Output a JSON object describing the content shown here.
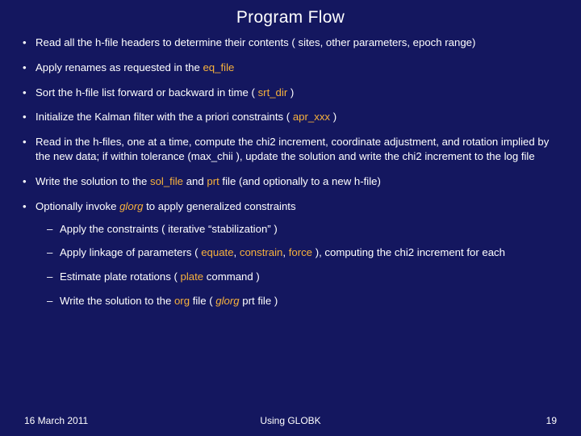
{
  "title": "Program Flow",
  "bullets": {
    "b1": "Read all the h-file headers to determine their contents ( sites, other parameters, epoch range)",
    "b2a": "Apply renames as requested in the ",
    "b2kw": "eq_file",
    "b3a": "Sort the h-file list  forward or backward in time ( ",
    "b3kw": "srt_dir",
    "b3b": " )",
    "b4a": "Initialize the Kalman filter with the a priori constraints ( ",
    "b4kw": "apr_xxx",
    "b4b": " )",
    "b5": "Read in the h-files, one at a time, compute the chi2 increment, coordinate adjustment, and rotation implied by the new data; if within tolerance (max_chii ), update the solution and write the chi2 increment to the log file",
    "b6a": "Write the solution to the ",
    "b6kw1": "sol_file",
    "b6b": " and ",
    "b6kw2": "prt",
    "b6c": " file (and optionally to a new h-file)",
    "b7a": "Optionally invoke ",
    "b7kw": "glorg",
    "b7b": " to apply generalized constraints"
  },
  "sub": {
    "s1": "Apply the constraints ( iterative “stabilization” )",
    "s2a": "Apply linkage of parameters ( ",
    "s2kw1": "equate",
    "s2b": ", ",
    "s2kw2": "constrain",
    "s2c": ", ",
    "s2kw3": "force",
    "s2d": " ), computing the chi2 increment for each",
    "s3a": "Estimate plate rotations  ( ",
    "s3kw": "plate",
    "s3b": " command )",
    "s4a": "Write the solution to the ",
    "s4kw1": "org",
    "s4b": " file  ( ",
    "s4kw2": "glorg",
    "s4c": " prt file )"
  },
  "footer": {
    "date": "16 March 2011",
    "center": "Using GLOBK",
    "page": "19"
  }
}
